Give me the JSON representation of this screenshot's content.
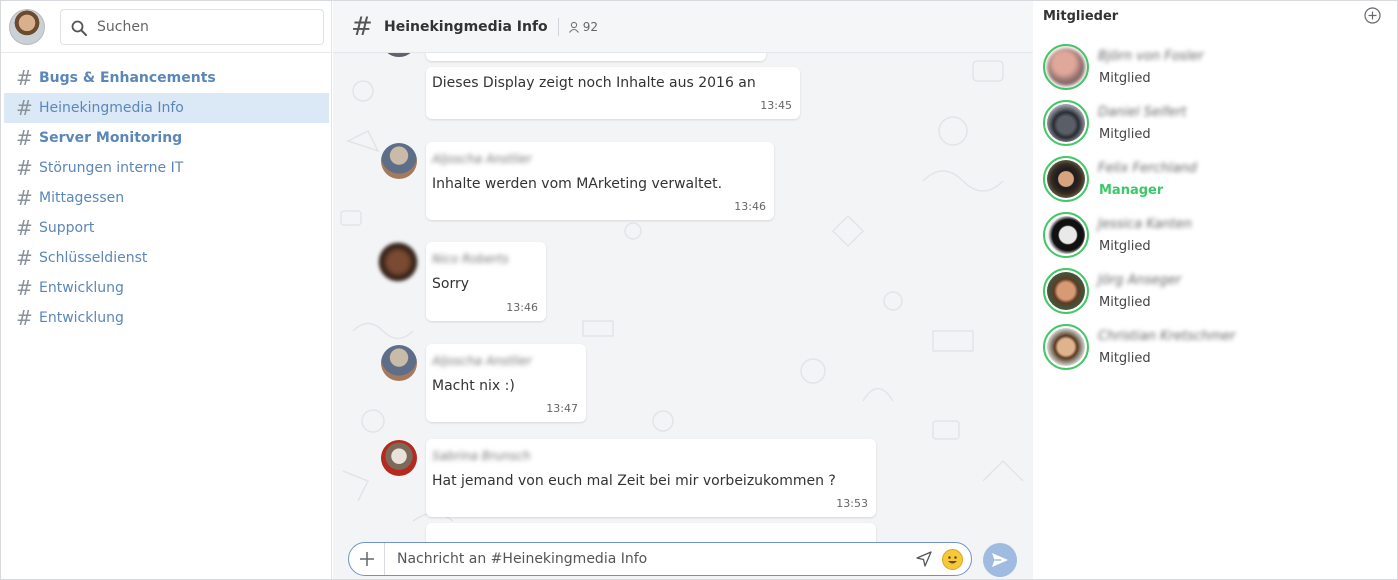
{
  "sidebar": {
    "search_placeholder": "Suchen",
    "channels": [
      {
        "label": "Bugs & Enhancements",
        "bold": true
      },
      {
        "label": "Heinekingmedia Info",
        "active": true
      },
      {
        "label": "Server Monitoring",
        "bold": true
      },
      {
        "label": "Störungen interne IT"
      },
      {
        "label": "Mittagessen"
      },
      {
        "label": "Support"
      },
      {
        "label": "Schlüsseldienst"
      },
      {
        "label": "Entwicklung"
      },
      {
        "label": "Entwicklung"
      }
    ]
  },
  "chat": {
    "title": "Heinekingmedia Info",
    "member_count": "92",
    "messages": [
      {
        "author": "",
        "text": "Dieses Display zeigt noch Inhalte aus 2016 an",
        "time": "13:45"
      },
      {
        "author": "Aljoscha Anstlier",
        "text": "Inhalte werden vom MArketing verwaltet.",
        "time": "13:46"
      },
      {
        "author": "Nico Roberts",
        "text": "Sorry",
        "time": "13:46"
      },
      {
        "author": "Aljoscha Anstlier",
        "text": "Macht nix :)",
        "time": "13:47"
      },
      {
        "author": "Sabrina Brunsch",
        "text": "Hat jemand von euch mal Zeit bei mir vorbeizukommen ?",
        "time": "13:53"
      }
    ],
    "composer_placeholder": "Nachricht an #Heinekingmedia Info"
  },
  "members": {
    "title": "Mitglieder",
    "list": [
      {
        "name": "Björn von Fosler",
        "role": "Mitglied"
      },
      {
        "name": "Daniel Seifert",
        "role": "Mitglied"
      },
      {
        "name": "Felix Ferchland",
        "role": "Manager"
      },
      {
        "name": "Jessica Kanten",
        "role": "Mitglied"
      },
      {
        "name": "Jörg Anseger",
        "role": "Mitglied"
      },
      {
        "name": "Christian Kretschmer",
        "role": "Mitglied"
      }
    ]
  },
  "colors": {
    "accent": "#5b87b8",
    "active_channel_bg": "#dbe8f6",
    "manager_green": "#3cc869",
    "online_ring": "#44c767",
    "send_button": "#9fbbe0"
  },
  "icons": [
    "search-icon",
    "hash-icon",
    "user-icon",
    "plus-icon",
    "paper-plane-icon",
    "emoji-icon",
    "add-circle-icon"
  ]
}
